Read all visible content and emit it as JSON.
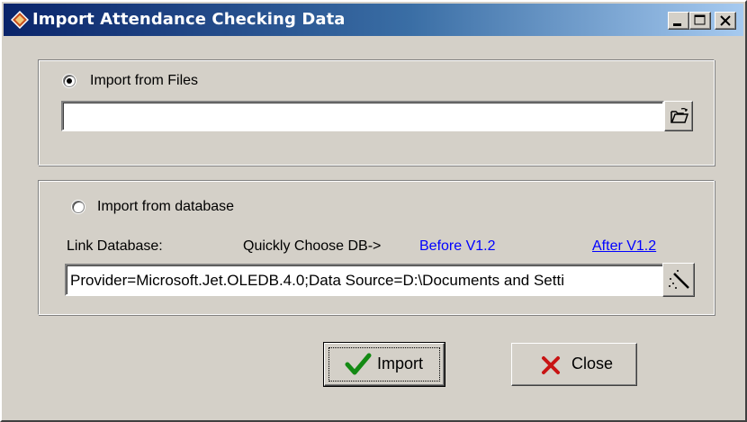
{
  "window": {
    "title": "Import Attendance Checking Data",
    "controls": {
      "minimize": "minimize",
      "maximize": "maximize",
      "close": "close"
    }
  },
  "files_section": {
    "radio_label": "Import from Files",
    "selected": true,
    "path_value": "",
    "browse_icon": "open-folder-icon"
  },
  "database_section": {
    "radio_label": "Import from database",
    "selected": false,
    "link_label": "Link Database:",
    "quick_label": "Quickly Choose DB->",
    "before_link": "Before V1.2",
    "after_link": "After V1.2",
    "connection_value": "Provider=Microsoft.Jet.OLEDB.4.0;Data Source=D:\\Documents and Setti",
    "wizard_icon": "magic-wand-icon"
  },
  "buttons": {
    "import_label": "Import",
    "close_label": "Close"
  },
  "colors": {
    "title_start": "#0a246a",
    "title_end": "#a6caf0",
    "face": "#d4d0c8",
    "link": "#0000ff"
  }
}
